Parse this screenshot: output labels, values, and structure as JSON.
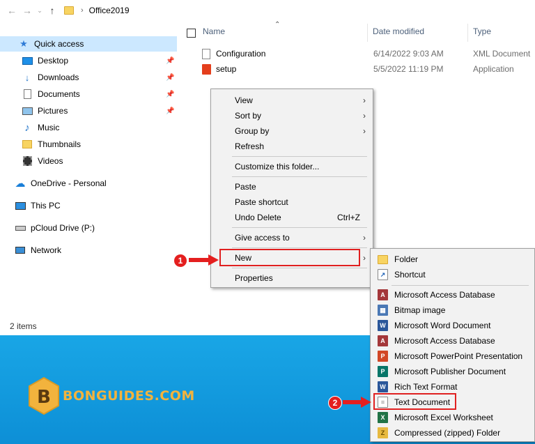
{
  "address": {
    "folder": "Office2019"
  },
  "nav": {
    "items": [
      {
        "label": "Quick access",
        "icon": "star-icon"
      },
      {
        "label": "Desktop",
        "icon": "desktop-icon",
        "pinned": true
      },
      {
        "label": "Downloads",
        "icon": "download-icon",
        "pinned": true
      },
      {
        "label": "Documents",
        "icon": "documents-icon",
        "pinned": true
      },
      {
        "label": "Pictures",
        "icon": "pictures-icon",
        "pinned": true
      },
      {
        "label": "Music",
        "icon": "music-icon"
      },
      {
        "label": "Thumbnails",
        "icon": "folder-icon"
      },
      {
        "label": "Videos",
        "icon": "video-icon"
      },
      {
        "label": "OneDrive - Personal",
        "icon": "cloud-icon"
      },
      {
        "label": "This PC",
        "icon": "pc-icon"
      },
      {
        "label": "pCloud Drive (P:)",
        "icon": "drive-icon"
      },
      {
        "label": "Network",
        "icon": "network-icon"
      }
    ]
  },
  "columns": {
    "name": "Name",
    "date": "Date modified",
    "type": "Type"
  },
  "files": [
    {
      "name": "Configuration",
      "date": "6/14/2022 9:03 AM",
      "type": "XML Document"
    },
    {
      "name": "setup",
      "date": "5/5/2022 11:19 PM",
      "type": "Application"
    }
  ],
  "status": "2 items",
  "context_menu": {
    "view": "View",
    "sort_by": "Sort by",
    "group_by": "Group by",
    "refresh": "Refresh",
    "customize": "Customize this folder...",
    "paste": "Paste",
    "paste_shortcut": "Paste shortcut",
    "undo_delete": "Undo Delete",
    "undo_shortcut": "Ctrl+Z",
    "give_access": "Give access to",
    "new": "New",
    "properties": "Properties"
  },
  "submenu": {
    "folder": "Folder",
    "shortcut": "Shortcut",
    "items": [
      {
        "label": "Microsoft Access Database",
        "color": "#a4373a",
        "glyph": "A"
      },
      {
        "label": "Bitmap image",
        "color": "#4a78b5",
        "glyph": "▦"
      },
      {
        "label": "Microsoft Word Document",
        "color": "#2b579a",
        "glyph": "W"
      },
      {
        "label": "Microsoft Access Database",
        "color": "#a4373a",
        "glyph": "A"
      },
      {
        "label": "Microsoft PowerPoint Presentation",
        "color": "#d24726",
        "glyph": "P"
      },
      {
        "label": "Microsoft Publisher Document",
        "color": "#077568",
        "glyph": "P"
      },
      {
        "label": "Rich Text Format",
        "color": "#2b579a",
        "glyph": "W"
      },
      {
        "label": "Text Document",
        "color": "#9a9a9a",
        "glyph": "≡"
      },
      {
        "label": "Microsoft Excel Worksheet",
        "color": "#217346",
        "glyph": "X"
      },
      {
        "label": "Compressed (zipped) Folder",
        "color": "#e7b93f",
        "glyph": "Z"
      }
    ]
  },
  "badges": {
    "one": "1",
    "two": "2"
  },
  "logo": {
    "text": "BONGUIDES.COM",
    "letter": "B"
  },
  "colors": {
    "selection": "#cce8ff",
    "desktop": "#129cdf",
    "highlight": "#e02020",
    "logo": "#f2b33d"
  }
}
